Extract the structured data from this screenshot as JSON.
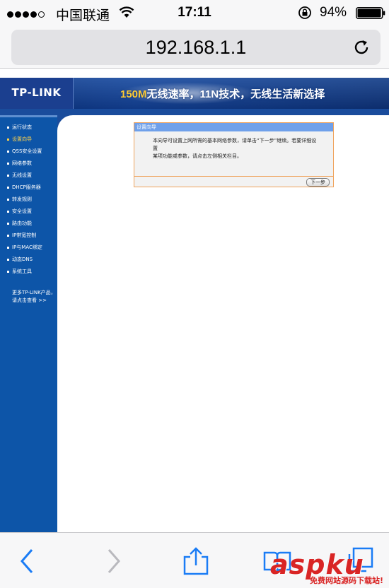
{
  "status_bar": {
    "carrier": "中国联通",
    "time": "17:11",
    "battery": "94%",
    "signal_bars": 4,
    "battery_level": 0.94
  },
  "browser": {
    "url": "192.168.1.1"
  },
  "header": {
    "logo": "TP-LINK",
    "slogan_highlight": "150M",
    "slogan": "无线速率，11N技术，无线生活新选择"
  },
  "sidebar": {
    "items": [
      {
        "label": "运行状态",
        "active": false
      },
      {
        "label": "设置向导",
        "active": true
      },
      {
        "label": "QSS安全设置",
        "active": false
      },
      {
        "label": "网络参数",
        "active": false
      },
      {
        "label": "无线设置",
        "active": false
      },
      {
        "label": "DHCP服务器",
        "active": false
      },
      {
        "label": "转发规则",
        "active": false
      },
      {
        "label": "安全设置",
        "active": false
      },
      {
        "label": "路由功能",
        "active": false
      },
      {
        "label": "IP带宽控制",
        "active": false
      },
      {
        "label": "IP与MAC绑定",
        "active": false
      },
      {
        "label": "动态DNS",
        "active": false
      },
      {
        "label": "系统工具",
        "active": false
      }
    ],
    "more_line1": "更多TP-LINK产品，",
    "more_line2": "请点击查看 >>"
  },
  "wizard": {
    "title": "设置向导",
    "body_line1": "本向导可设置上网所需的基本网络参数，请单击“下一步”继续。若要详细设置",
    "body_line2": "某项功能或参数，请点击左侧相关栏目。",
    "next_button": "下一步"
  },
  "toolbar": {
    "icons": [
      "back-icon",
      "forward-icon",
      "share-icon",
      "bookmarks-icon",
      "tabs-icon"
    ]
  },
  "watermark": {
    "brand": "aspku",
    "tagline": "免费网站源码下载站!"
  },
  "colors": {
    "nav_blue": "#0d55a8",
    "active_nav": "#ffd24a",
    "wizard_border": "#f0a35c",
    "ios_blue": "#1a7cf5"
  }
}
